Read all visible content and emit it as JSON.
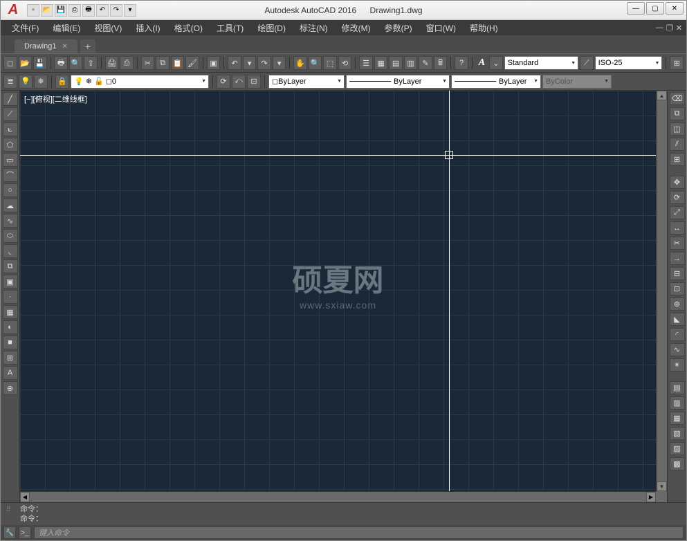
{
  "title": {
    "app": "Autodesk AutoCAD 2016",
    "document": "Drawing1.dwg"
  },
  "menus": [
    "文件(F)",
    "编辑(E)",
    "视图(V)",
    "插入(I)",
    "格式(O)",
    "工具(T)",
    "绘图(D)",
    "标注(N)",
    "修改(M)",
    "参数(P)",
    "窗口(W)",
    "帮助(H)"
  ],
  "tab": {
    "name": "Drawing1"
  },
  "toolbar1": {
    "text_style": "Standard",
    "dim_style": "ISO-25",
    "text_label": "A"
  },
  "toolbar2": {
    "layer": "0",
    "linetype": "ByLayer",
    "lineweight": "ByLayer",
    "plotstyle": "ByLayer",
    "color": "ByColor"
  },
  "viewport_label": "[−][俯视][二维线框]",
  "watermark": {
    "main": "硕夏网",
    "sub": "www.sxiaw.com"
  },
  "command": {
    "history1": "命令：",
    "history2": "命令：",
    "placeholder": "键入命令"
  }
}
